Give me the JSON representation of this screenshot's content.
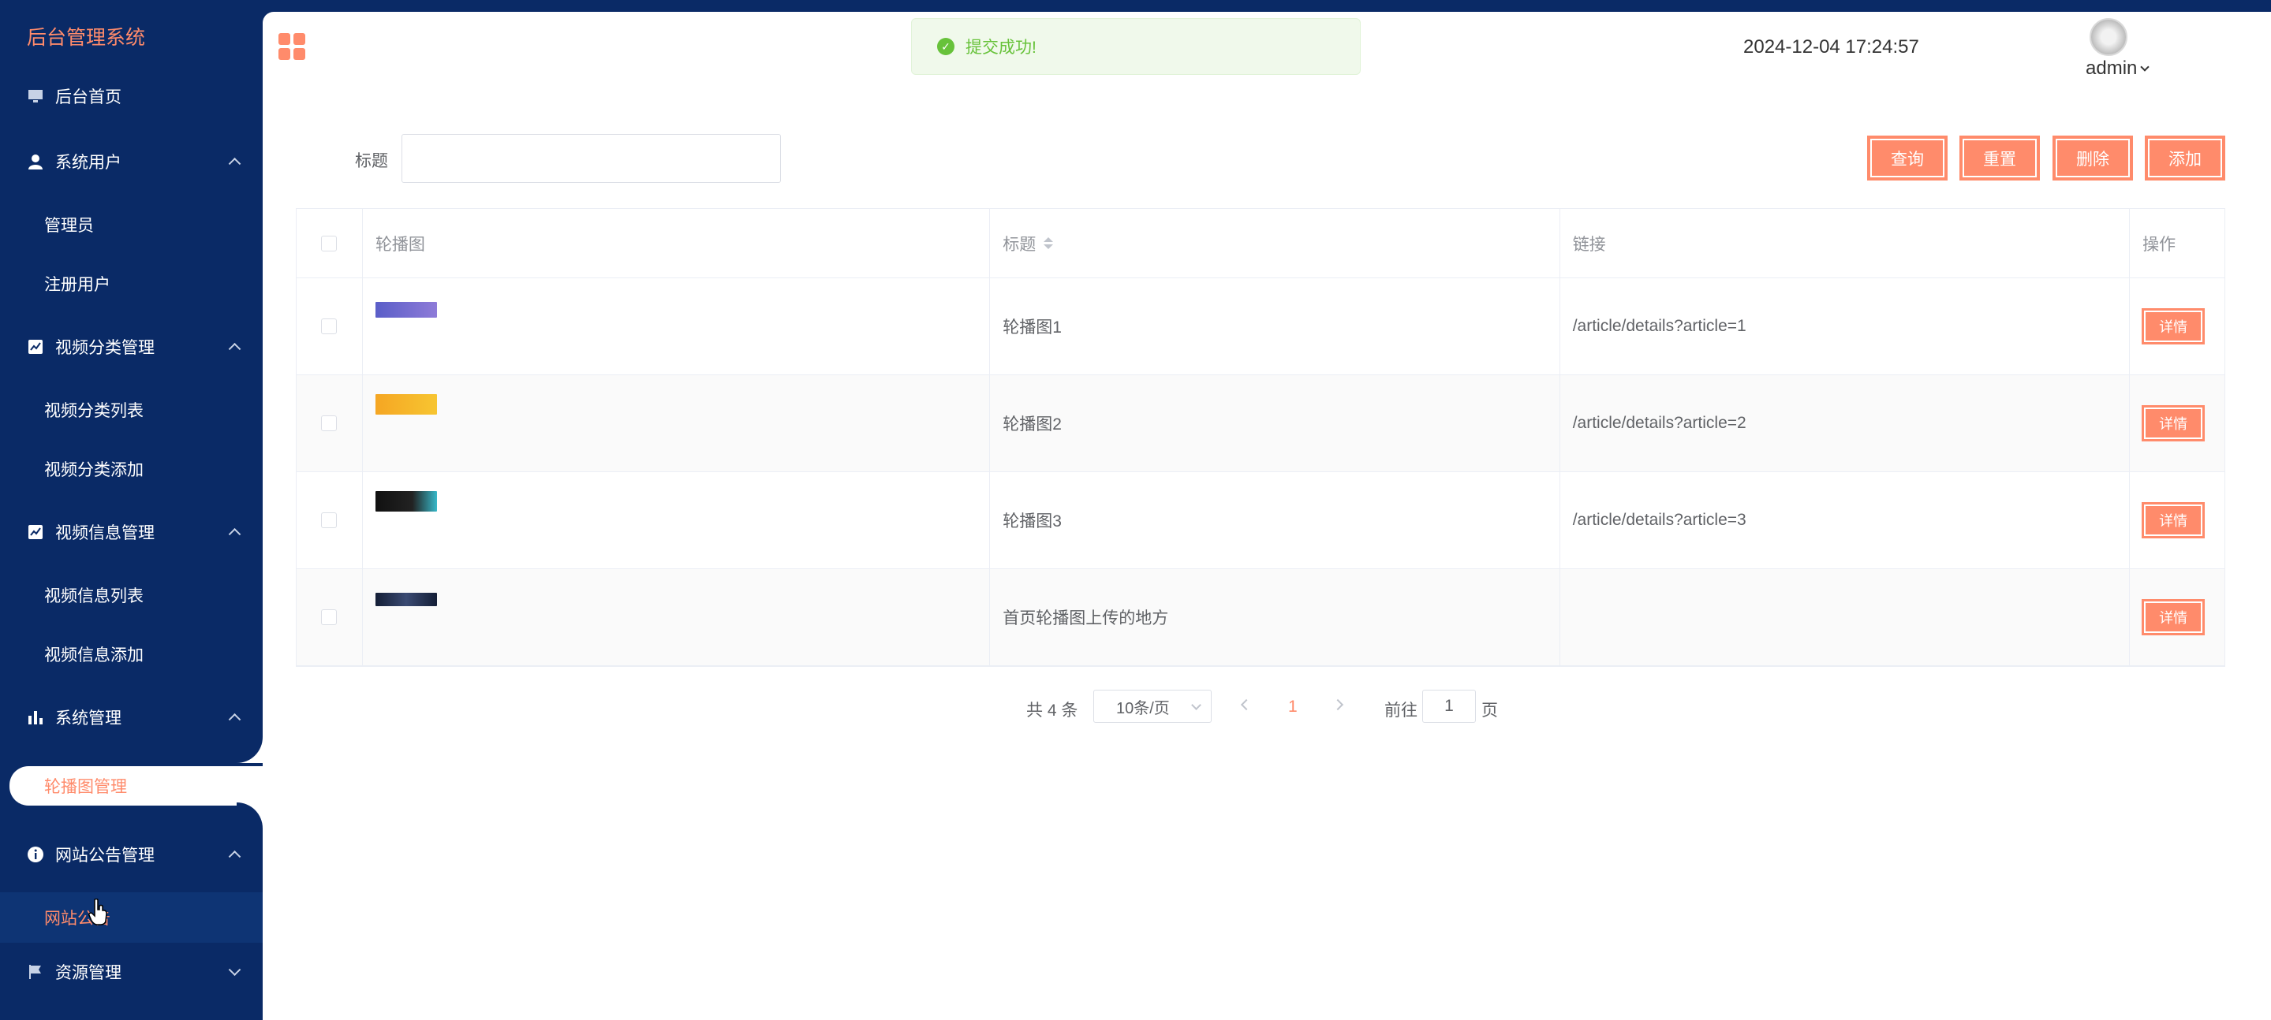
{
  "app": {
    "title": "后台管理系统"
  },
  "sidebar": {
    "items": [
      {
        "label": "后台首页",
        "icon": "monitor-icon"
      },
      {
        "label": "系统用户",
        "icon": "user-icon",
        "children": [
          "管理员",
          "注册用户"
        ]
      },
      {
        "label": "视频分类管理",
        "icon": "chart-icon",
        "children": [
          "视频分类列表",
          "视频分类添加"
        ]
      },
      {
        "label": "视频信息管理",
        "icon": "chart-icon",
        "children": [
          "视频信息列表",
          "视频信息添加"
        ]
      },
      {
        "label": "系统管理",
        "icon": "bar-chart-icon",
        "children": [
          "轮播图管理"
        ]
      },
      {
        "label": "网站公告管理",
        "icon": "info-icon",
        "children": [
          "网站公告"
        ]
      },
      {
        "label": "资源管理",
        "icon": "flag-icon"
      }
    ],
    "active": "轮播图管理"
  },
  "header": {
    "toast": "提交成功!",
    "datetime": "2024-12-04 17:24:57",
    "username": "admin"
  },
  "search": {
    "label": "标题",
    "value": "",
    "placeholder": ""
  },
  "toolbar": {
    "query": "查询",
    "reset": "重置",
    "delete": "删除",
    "add": "添加"
  },
  "table": {
    "columns": [
      "轮播图",
      "标题",
      "链接",
      "操作"
    ],
    "rows": [
      {
        "title": "轮播图1",
        "link": "/article/details?article=1",
        "action": "详情",
        "thumb_color": "#6c6fd6"
      },
      {
        "title": "轮播图2",
        "link": "/article/details?article=2",
        "action": "详情",
        "thumb_color": "#f7a21b"
      },
      {
        "title": "轮播图3",
        "link": "/article/details?article=3",
        "action": "详情",
        "thumb_color": "#1c1c2a"
      },
      {
        "title": "首页轮播图上传的地方",
        "link": "",
        "action": "详情",
        "thumb_color": "#1a2742"
      }
    ]
  },
  "pagination": {
    "total": "共 4 条",
    "page_size": "10条/页",
    "current_page": "1",
    "goto_label": "前往",
    "goto_value": "1",
    "goto_unit": "页"
  },
  "colors": {
    "accent": "#ff8b6b",
    "sidebar": "#0a2a66",
    "success": "#67c23a"
  }
}
